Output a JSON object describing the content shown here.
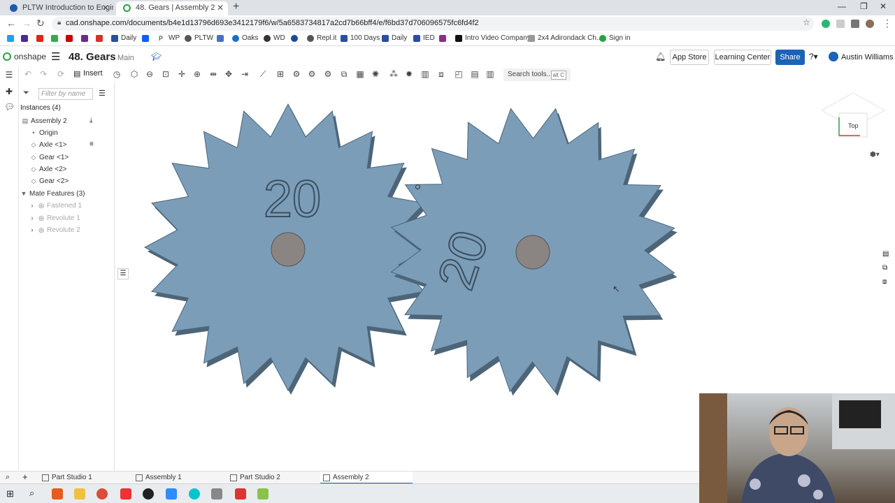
{
  "browser": {
    "tabs": [
      {
        "label": "PLTW Introduction to Engineering"
      },
      {
        "label": "48. Gears | Assembly 2"
      }
    ],
    "url": "cad.onshape.com/documents/b4e1d13796d693e3412179f6/w/5a6583734817a2cd7b66bff4/e/f6bd37d706096575fc6fd4f2",
    "bookmarks": [
      "Daily",
      "WP",
      "PLTW",
      "Oaks",
      "WD",
      "Repl.it",
      "100 Days",
      "Daily",
      "IED",
      "Intro Video Company",
      "2x4 Adirondack Ch...",
      "Sign in"
    ]
  },
  "header": {
    "logo": "onshape",
    "doc_title": "48. Gears",
    "branch": "Main",
    "app_store": "App Store",
    "learning_center": "Learning Center",
    "share": "Share",
    "user": "Austin Williams"
  },
  "toolbar": {
    "insert_label": "Insert",
    "search_tools": "Search tools...",
    "search_kbd": "alt C"
  },
  "panel": {
    "filter_placeholder": "Filter by name",
    "instances_header": "Instances (4)",
    "instances": [
      {
        "label": "Assembly 2"
      },
      {
        "label": "Origin"
      },
      {
        "label": "Axle <1>"
      },
      {
        "label": "Gear <1>"
      },
      {
        "label": "Axle <2>"
      },
      {
        "label": "Gear <2>"
      }
    ],
    "mates_header": "Mate Features (3)",
    "mates": [
      {
        "label": "Fastened 1"
      },
      {
        "label": "Revolute 1"
      },
      {
        "label": "Revolute 2"
      }
    ]
  },
  "canvas": {
    "gear1_label": "20",
    "gear2_label": "20",
    "view_cube": "Top",
    "colors": {
      "gear": "#7b9db8",
      "gear_edge": "#4d6578",
      "axle": "#8a8582"
    }
  },
  "doc_tabs": [
    {
      "label": "Part Studio 1"
    },
    {
      "label": "Assembly 1"
    },
    {
      "label": "Part Studio 2"
    },
    {
      "label": "Assembly 2"
    }
  ]
}
